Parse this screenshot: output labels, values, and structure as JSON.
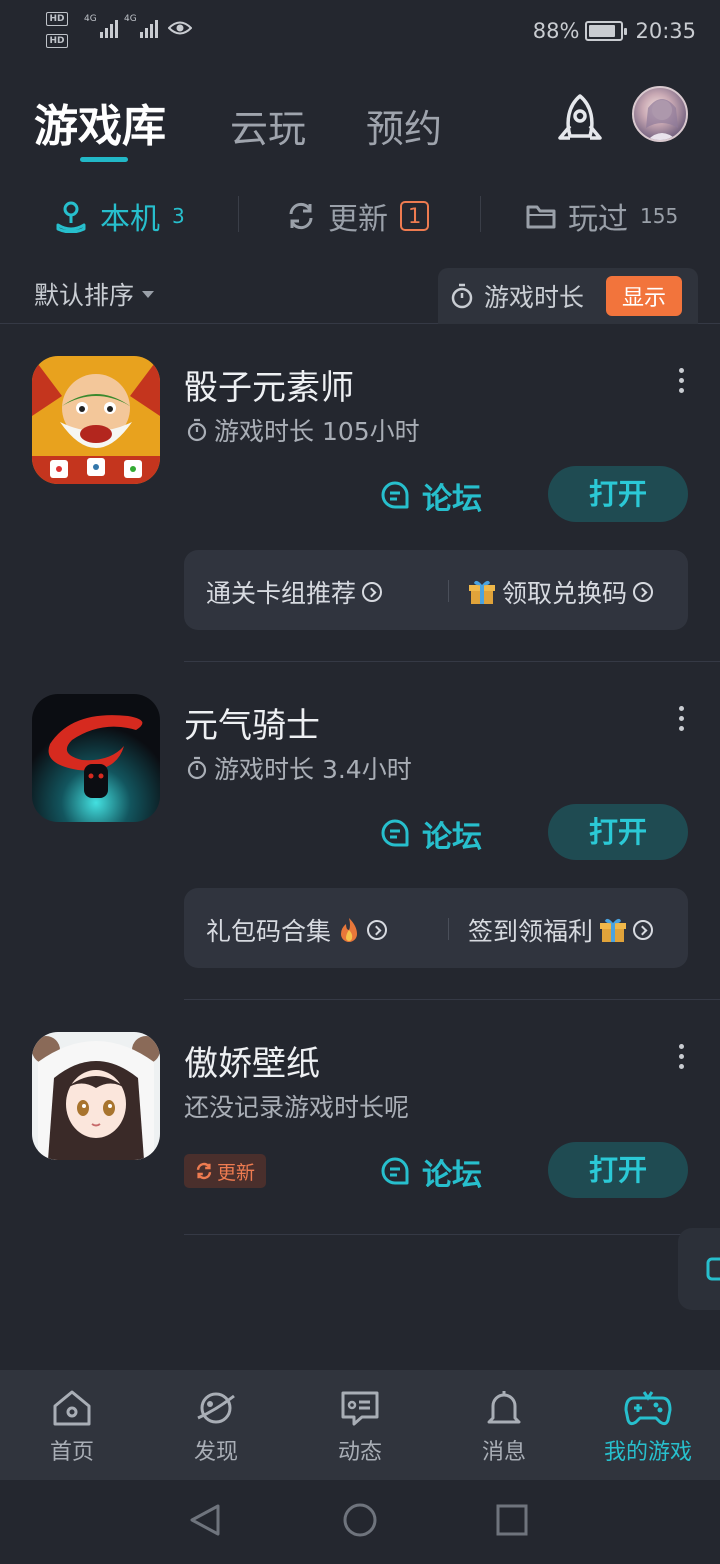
{
  "status_bar": {
    "hd1": "HD",
    "hd2": "HD",
    "net1": "4G",
    "net2": "4G",
    "battery": "88%",
    "time": "20:35",
    "battery_level": 0.88
  },
  "header": {
    "tabs": [
      {
        "label": "游戏库",
        "active": true
      },
      {
        "label": "云玩",
        "active": false
      },
      {
        "label": "预约",
        "active": false
      }
    ],
    "rocket_icon": "rocket-icon",
    "avatar": "user-avatar"
  },
  "subtabs": [
    {
      "label": "本机",
      "count": "3",
      "icon": "joystick-icon",
      "active": true
    },
    {
      "label": "更新",
      "count": "1",
      "icon": "refresh-icon",
      "active": false
    },
    {
      "label": "玩过",
      "count": "155",
      "icon": "folder-icon",
      "active": false
    }
  ],
  "sort_bar": {
    "sort_label": "默认排序",
    "duration_label": "游戏时长",
    "show_button": "显示"
  },
  "games": [
    {
      "name": "骰子元素师",
      "playtime": "游戏时长 105小时",
      "forum": "论坛",
      "open": "打开",
      "links": [
        "通关卡组推荐",
        "领取兑换码"
      ]
    },
    {
      "name": "元气骑士",
      "playtime": "游戏时长 3.4小时",
      "forum": "论坛",
      "open": "打开",
      "links": [
        "礼包码合集",
        "签到领福利"
      ]
    },
    {
      "name": "傲娇壁纸",
      "playtime": "还没记录游戏时长呢",
      "forum": "论坛",
      "open": "打开",
      "update_tag": "更新"
    }
  ],
  "bottom_nav": [
    {
      "label": "首页",
      "icon": "home-icon",
      "active": false
    },
    {
      "label": "发现",
      "icon": "planet-icon",
      "active": false
    },
    {
      "label": "动态",
      "icon": "message-icon",
      "active": false
    },
    {
      "label": "消息",
      "icon": "bell-icon",
      "active": false
    },
    {
      "label": "我的游戏",
      "icon": "gamepad-icon",
      "active": true
    }
  ],
  "colors": {
    "background": "#24272f",
    "accent": "#27bfcd",
    "orange": "#f2743c",
    "open_button_bg": "#1f4b52"
  }
}
